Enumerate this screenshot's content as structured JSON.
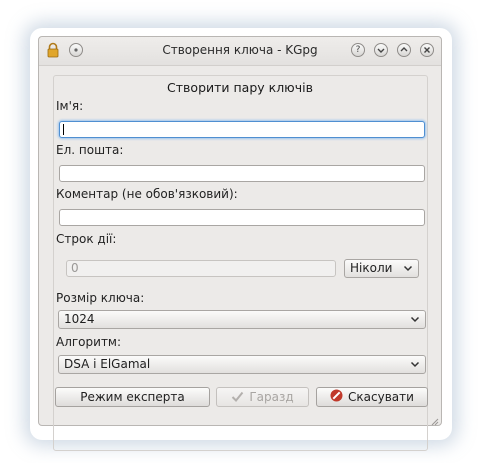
{
  "window": {
    "title": "Створення ключа - KGpg"
  },
  "form": {
    "heading": "Створити пару ключів",
    "name": {
      "label": "Ім'я:",
      "value": ""
    },
    "email": {
      "label": "Ел. пошта:",
      "value": ""
    },
    "comment": {
      "label": "Коментар (не обов'язковий):",
      "value": ""
    },
    "expiry": {
      "label": "Строк дії:",
      "value": "0",
      "unit": "Ніколи"
    },
    "key_size": {
      "label": "Розмір ключа:",
      "value": "1024"
    },
    "algorithm": {
      "label": "Алгоритм:",
      "value": "DSA і ElGamal"
    }
  },
  "buttons": {
    "expert": "Режим експерта",
    "ok": "Гаразд",
    "cancel": "Скасувати"
  },
  "icons": {
    "lock": "lock-icon",
    "menu": "window-menu-icon",
    "help": "help-icon",
    "minimize": "minimize-icon",
    "maximize": "maximize-icon",
    "close": "close-icon",
    "ok": "checkmark-icon",
    "cancel": "cancel-icon"
  },
  "colors": {
    "focus": "#4f8fd1",
    "cancel_icon": "#c0392b",
    "window_bg": "#eceae8"
  }
}
